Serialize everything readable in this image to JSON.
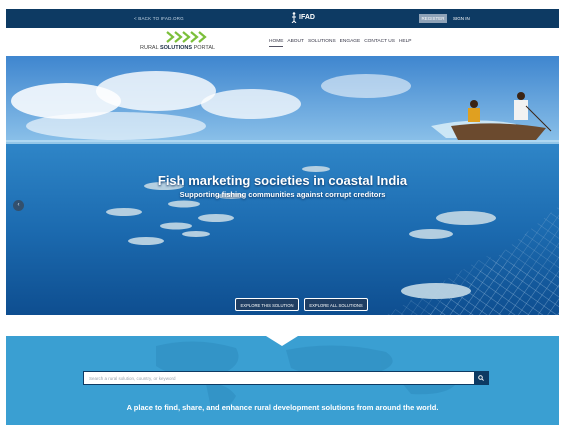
{
  "topbar": {
    "back_link": "< BACK TO IFAD.ORG",
    "logo_text": "IFAD",
    "register_label": "REGISTER",
    "signin_label": "SIGN IN"
  },
  "navbar": {
    "portal_name_prefix": "RURAL",
    "portal_name_bold": "SOLUTIONS",
    "portal_name_suffix": "PORTAL",
    "menu": [
      {
        "label": "HOME",
        "active": true
      },
      {
        "label": "ABOUT"
      },
      {
        "label": "SOLUTIONS"
      },
      {
        "label": "ENGAGE"
      },
      {
        "label": "CONTACT US"
      },
      {
        "label": "HELP"
      }
    ]
  },
  "hero": {
    "title": "Fish marketing societies in coastal India",
    "subtitle": "Supporting fishing communities against corrupt creditors",
    "prev_arrow": "‹",
    "explore_this_label": "EXPLORE THIS SOLUTION",
    "explore_all_label": "EXPLORE ALL SOLUTIONS"
  },
  "search": {
    "placeholder": "Search a rural solution, country, or keyword",
    "tagline": "A place to find, share, and enhance rural development solutions from around the world."
  },
  "icons": {
    "search": "search-icon",
    "ifad_logo": "ifad-figure-icon",
    "portal_logo": "portal-arrows-icon"
  },
  "colors": {
    "topbar": "#0d3a63",
    "brand_green": "#7bbf3a",
    "search_band": "#3a9fd2",
    "button_navy": "#1f3e63"
  }
}
